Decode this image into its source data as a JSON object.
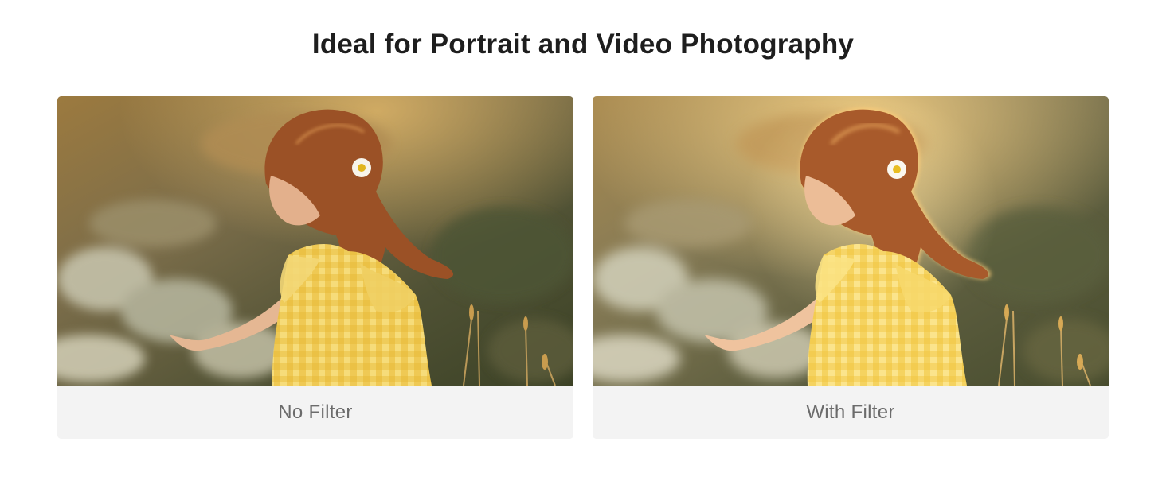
{
  "header": {
    "title": "Ideal for Portrait and Video Photography"
  },
  "comparison": [
    {
      "label": "No Filter",
      "filtered": false
    },
    {
      "label": "With Filter",
      "filtered": true
    }
  ],
  "colors": {
    "title_text": "#1e1e1e",
    "caption_text": "#6b6b6b",
    "caption_background": "#f3f3f3",
    "dress_yellow": "#f2cd4f",
    "hair_auburn": "#a1532b"
  }
}
